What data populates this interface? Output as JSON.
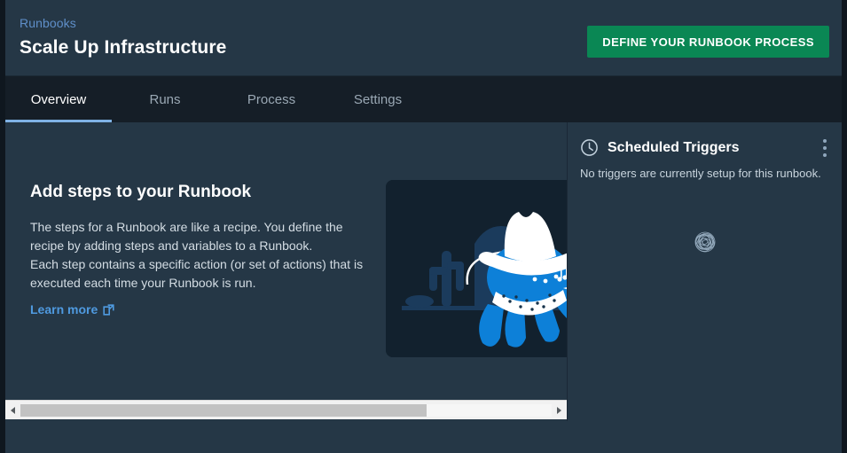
{
  "header": {
    "breadcrumb": "Runbooks",
    "title": "Scale Up Infrastructure",
    "primary_button_label": "DEFINE YOUR RUNBOOK PROCESS"
  },
  "tabs": [
    {
      "label": "Overview",
      "active": true
    },
    {
      "label": "Runs",
      "active": false
    },
    {
      "label": "Process",
      "active": false
    },
    {
      "label": "Settings",
      "active": false
    }
  ],
  "main": {
    "empty_state": {
      "heading": "Add steps to your Runbook",
      "body": "The steps for a Runbook are like a recipe. You define the recipe by adding steps and variables to a Runbook.\nEach step contains a specific action (or set of actions) that is executed each time your Runbook is run.",
      "link_label": "Learn more",
      "link_icon": "external-link-icon"
    },
    "illustration": {
      "name": "cowboy-octopus-desert-illustration",
      "alt": "Octopus mascot wearing a cowboy hat and bandana holding a lasso in a desert with a cactus and mesa"
    },
    "scrollbar": {
      "left_arrow_icon": "chevron-left-icon",
      "right_arrow_icon": "chevron-right-icon",
      "thumb_position_percent": 0
    }
  },
  "sidebar": {
    "icon": "clock-icon",
    "title": "Scheduled Triggers",
    "menu_icon": "vertical-dots-icon",
    "status_text": "No triggers are currently setup for this runbook.",
    "loading_icon": "scribble-spinner-icon"
  },
  "colors": {
    "page_background": "#253746",
    "outer_background": "#0f171f",
    "tab_bar": "#151e27",
    "accent_green": "#0a8754",
    "accent_blue": "#4f9ae0",
    "tab_underline": "#7fb2e5",
    "breadcrumb_blue": "#5f8fc9",
    "card_background": "#12212e",
    "octopus_blue": "#0d80d8",
    "scrollbar_track": "#f1f1f1",
    "scrollbar_thumb": "#c2c2c2"
  }
}
